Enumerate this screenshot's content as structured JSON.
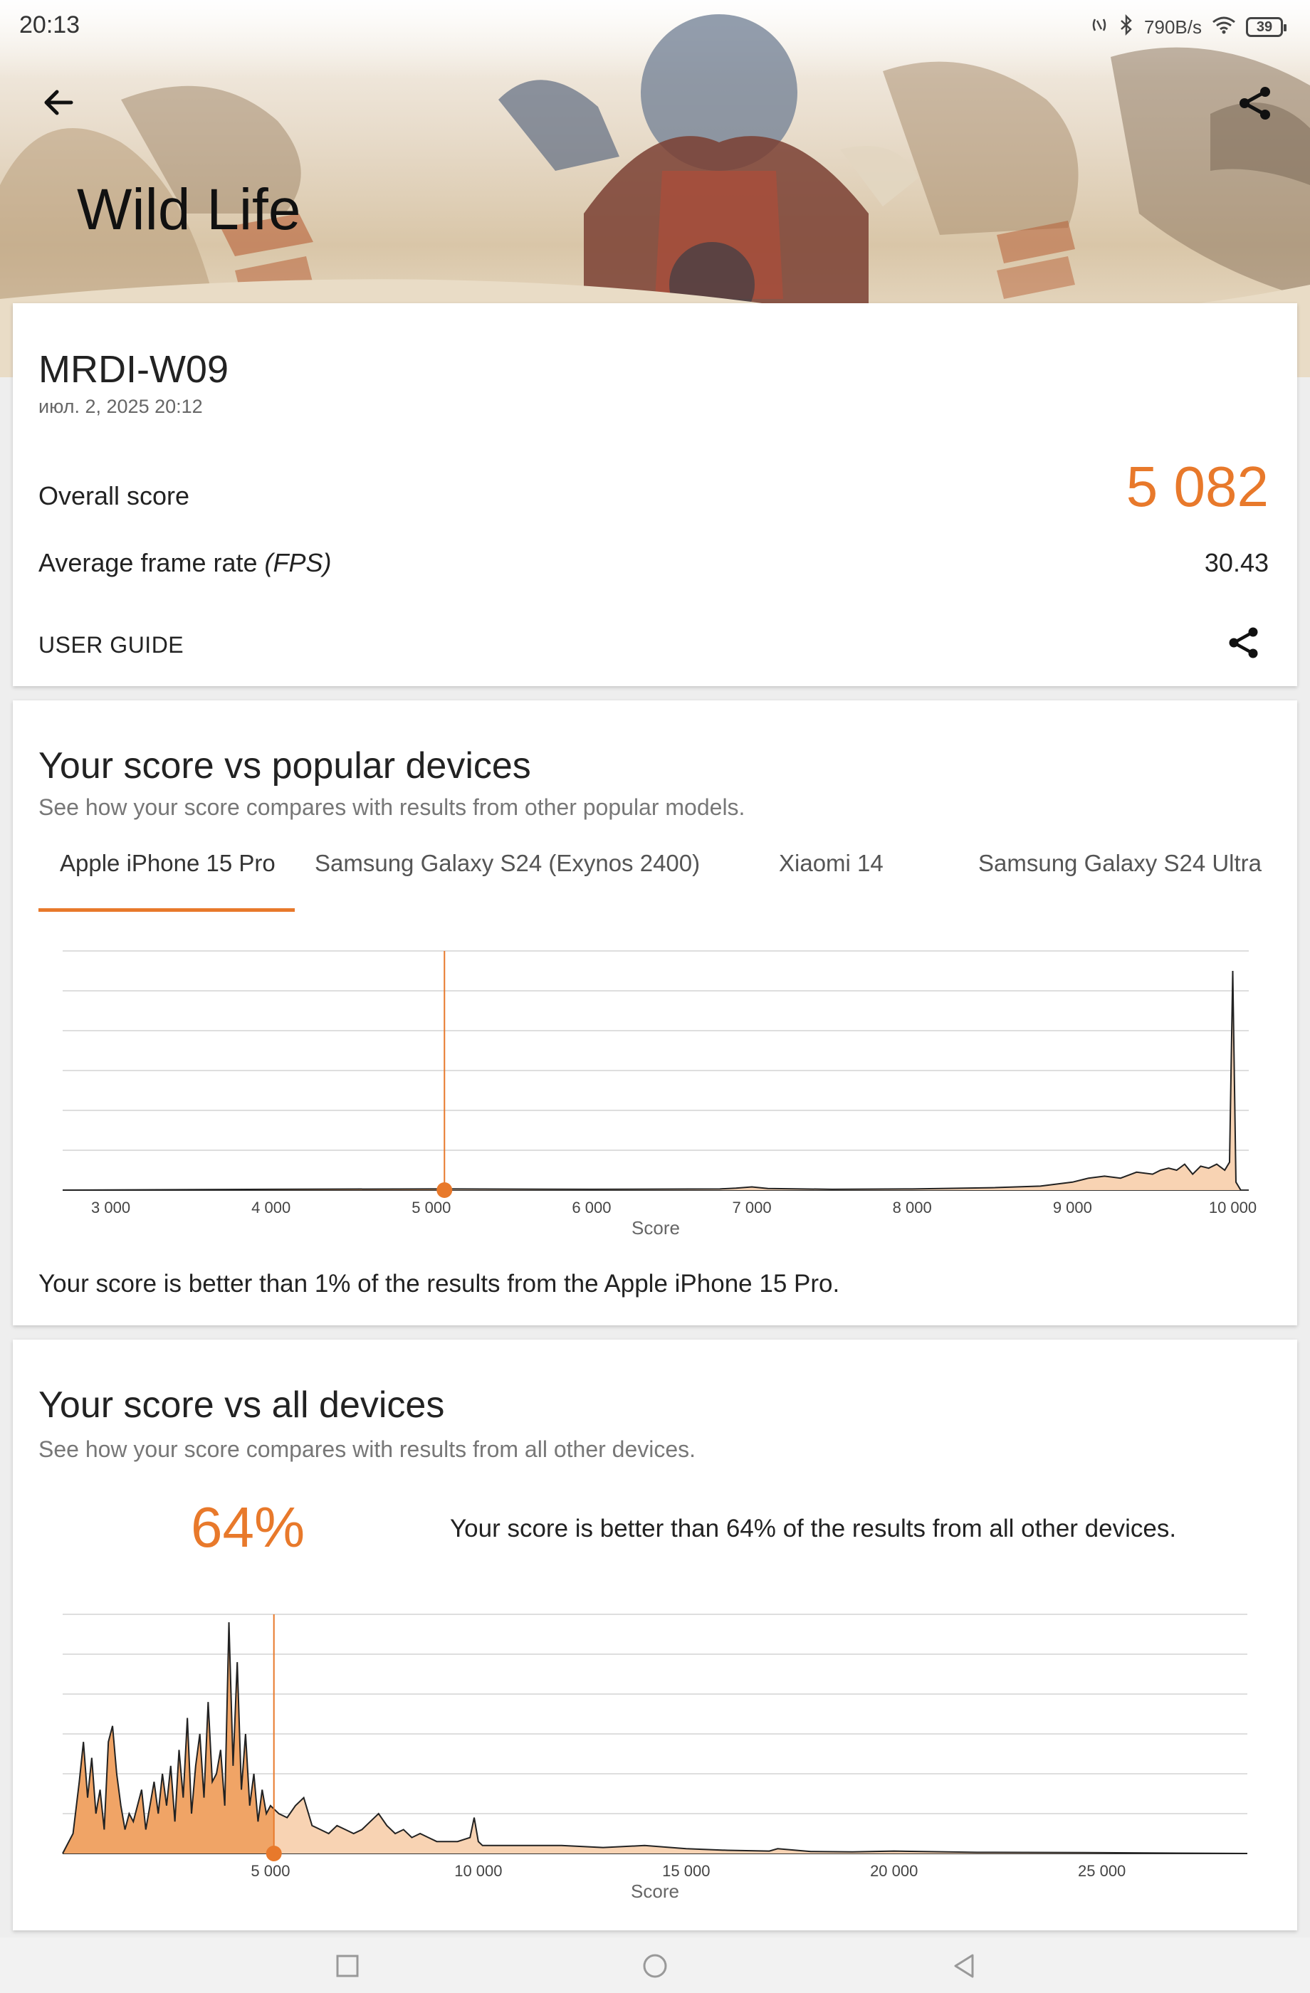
{
  "status_bar": {
    "time": "20:13",
    "net_speed": "790B/s",
    "battery": "39"
  },
  "header": {
    "title": "Wild Life"
  },
  "result": {
    "device": "MRDI-W09",
    "date": "июл. 2, 2025 20:12",
    "overall_label": "Overall score",
    "overall_value": "5 082",
    "fps_label": "Average frame rate",
    "fps_unit": "(FPS)",
    "fps_value": "30.43",
    "guide_label": "USER GUIDE"
  },
  "popular": {
    "title": "Your score vs popular devices",
    "subtitle": "See how your score compares with results from other popular models.",
    "tabs": [
      {
        "label": "Apple iPhone 15 Pro",
        "active": true
      },
      {
        "label": "Samsung Galaxy S24 (Exynos 2400)",
        "active": false
      },
      {
        "label": "Xiaomi 14",
        "active": false
      },
      {
        "label": "Samsung Galaxy S24 Ultra",
        "active": false
      }
    ],
    "note": "Your score is better than 1% of the results from the Apple iPhone 15 Pro."
  },
  "all_devices": {
    "title": "Your score vs all devices",
    "subtitle": "See how your score compares with results from all other devices.",
    "percent": "64%",
    "note": "Your score is better than 64% of the results from all other devices."
  },
  "colors": {
    "accent": "#e8792b",
    "fill_light": "#f8d3b3",
    "fill_dark": "#f0a466"
  },
  "chart_data": [
    {
      "type": "area",
      "xlabel": "Score",
      "xlim": [
        2700,
        10100
      ],
      "xticks": [
        "3 000",
        "4 000",
        "5 000",
        "6 000",
        "7 000",
        "8 000",
        "9 000",
        "10 000"
      ],
      "xtick_values": [
        3000,
        4000,
        5000,
        6000,
        7000,
        8000,
        9000,
        10000
      ],
      "marker": 5082,
      "ylim": [
        0,
        60
      ],
      "x": [
        2700,
        4000,
        5000,
        6000,
        6800,
        6900,
        7000,
        7100,
        7500,
        8000,
        8500,
        8800,
        9000,
        9100,
        9200,
        9300,
        9400,
        9500,
        9550,
        9600,
        9650,
        9700,
        9750,
        9800,
        9850,
        9900,
        9950,
        9980,
        10000,
        10020,
        10050
      ],
      "values": [
        0,
        0.2,
        0.3,
        0.2,
        0.3,
        0.5,
        0.8,
        0.4,
        0.2,
        0.3,
        0.6,
        1.0,
        2.0,
        3.0,
        3.5,
        3.0,
        4.5,
        4.0,
        5.0,
        5.5,
        5.0,
        6.5,
        4.0,
        6.0,
        5.5,
        6.5,
        5.0,
        7.0,
        55,
        2.0,
        0
      ]
    },
    {
      "type": "area",
      "xlabel": "Score",
      "xlim": [
        0,
        28500
      ],
      "xticks": [
        "5 000",
        "10 000",
        "15 000",
        "20 000",
        "25 000"
      ],
      "xtick_values": [
        5000,
        10000,
        15000,
        20000,
        25000
      ],
      "marker": 5082,
      "ylim": [
        0,
        60
      ],
      "x": [
        0,
        250,
        400,
        500,
        600,
        700,
        800,
        900,
        1000,
        1100,
        1200,
        1300,
        1400,
        1500,
        1600,
        1700,
        1800,
        1900,
        2000,
        2100,
        2200,
        2300,
        2400,
        2500,
        2600,
        2700,
        2800,
        2900,
        3000,
        3100,
        3200,
        3300,
        3400,
        3500,
        3600,
        3700,
        3800,
        3900,
        4000,
        4100,
        4200,
        4300,
        4400,
        4500,
        4600,
        4700,
        4800,
        4900,
        5000,
        5200,
        5400,
        5600,
        5800,
        6000,
        6200,
        6400,
        6600,
        6800,
        7000,
        7200,
        7400,
        7600,
        7800,
        8000,
        8200,
        8400,
        8600,
        8800,
        9000,
        9500,
        9800,
        9900,
        10000,
        10100,
        11000,
        12000,
        13000,
        14000,
        15000,
        16000,
        17000,
        17200,
        18000,
        19000,
        20000,
        22000,
        25000,
        28500
      ],
      "values": [
        0,
        5,
        18,
        28,
        14,
        24,
        10,
        16,
        6,
        28,
        32,
        20,
        12,
        6,
        10,
        8,
        12,
        16,
        6,
        12,
        18,
        10,
        20,
        12,
        22,
        8,
        26,
        14,
        34,
        10,
        22,
        30,
        14,
        38,
        18,
        20,
        26,
        12,
        58,
        22,
        48,
        16,
        30,
        12,
        20,
        8,
        16,
        10,
        12,
        10,
        9,
        12,
        14,
        7,
        6,
        5,
        7,
        6,
        5,
        6,
        8,
        10,
        7,
        5,
        6,
        4,
        5,
        4,
        3,
        3,
        4,
        9,
        3,
        2,
        2,
        2,
        1.5,
        2,
        1.2,
        0.8,
        0.6,
        1.2,
        0.5,
        0.4,
        0.6,
        0.3,
        0.2,
        0
      ]
    }
  ]
}
